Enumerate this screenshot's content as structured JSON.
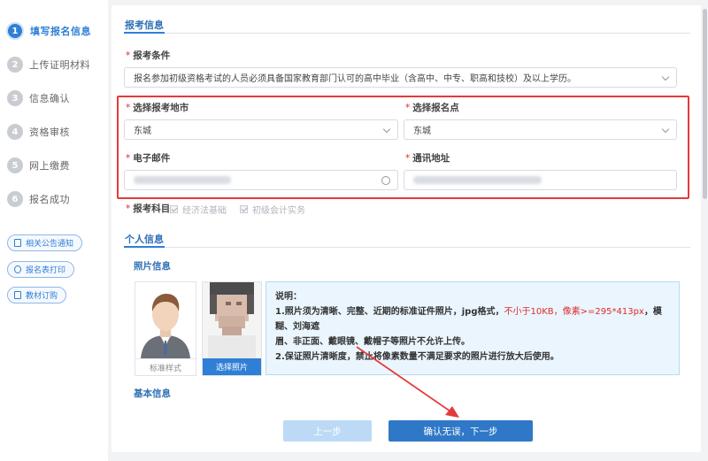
{
  "steps": [
    {
      "num": "1",
      "label": "填写报名信息"
    },
    {
      "num": "2",
      "label": "上传证明材料"
    },
    {
      "num": "3",
      "label": "信息确认"
    },
    {
      "num": "4",
      "label": "资格审核"
    },
    {
      "num": "5",
      "label": "网上缴费"
    },
    {
      "num": "6",
      "label": "报名成功"
    }
  ],
  "side_buttons": [
    "相关公告通知",
    "报名表打印",
    "教材订购"
  ],
  "exam_info": {
    "section_title": "报考信息",
    "condition_label": "报考条件",
    "condition_value": "报名参加初级资格考试的人员必须具备国家教育部门认可的高中毕业（含高中、中专、职高和技校）及以上学历。",
    "city_label": "选择报考地市",
    "city_value": "东城",
    "site_label": "选择报名点",
    "site_value": "东城",
    "email_label": "电子邮件",
    "address_label": "通讯地址",
    "subjects_label": "报考科目",
    "subjects": [
      "经济法基础",
      "初级会计实务"
    ]
  },
  "personal": {
    "section_title": "个人信息",
    "photo_title": "照片信息",
    "sample_caption": "标准样式",
    "select_photo_label": "选择照片",
    "info_title": "说明：",
    "info_line1_a": "1.照片须为清晰、完整、近期的标准证件照片，jpg格式，",
    "info_line1_red": "不小于10KB，像素>=295*413px",
    "info_line1_b": "，模糊、刘海遮",
    "info_line2": "眉、非正面、戴眼镜、戴帽子等照片不允许上传。",
    "info_line3": "2.保证照片清晰度，禁止将像素数量不满足要求的照片进行放大后使用。",
    "basic_title": "基本信息"
  },
  "actions": {
    "prev_label": "上一步",
    "next_label": "确认无误，下一步"
  },
  "colors": {
    "accent": "#2f7fd6",
    "highlight_frame": "#e43a3a",
    "required": "#e02b2b"
  }
}
